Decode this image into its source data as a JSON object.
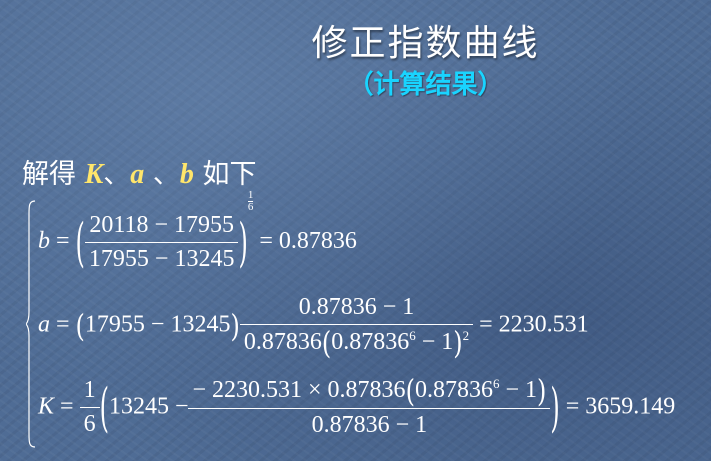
{
  "title": "修正指数曲线",
  "subtitle": "（计算结果）",
  "intro": {
    "prefix": "解得",
    "K": "K",
    "sep1": "、",
    "a": "a",
    "sep2": "、",
    "b": "b",
    "suffix": "如下"
  },
  "eq_b": {
    "lhs": "b",
    "num": "20118 − 17955",
    "den": "17955 − 13245",
    "exp_num": "1",
    "exp_den": "6",
    "result": "= 0.87836"
  },
  "eq_a": {
    "lhs": "a",
    "factor": "17955 − 13245",
    "num": "0.87836 − 1",
    "den_left": "0.87836",
    "den_inner": "0.87836",
    "den_inner_exp": "6",
    "den_inner_tail": " − 1",
    "den_exp": "2",
    "result": "= 2230.531"
  },
  "eq_K": {
    "lhs": "K",
    "coef_num": "1",
    "coef_den": "6",
    "first": "13245 −",
    "num_left": "− 2230.531 × 0.87836",
    "num_inner": "0.87836",
    "num_inner_exp": "6",
    "num_inner_tail": " − 1",
    "den": "0.87836 − 1",
    "result": "= 3659.149"
  }
}
